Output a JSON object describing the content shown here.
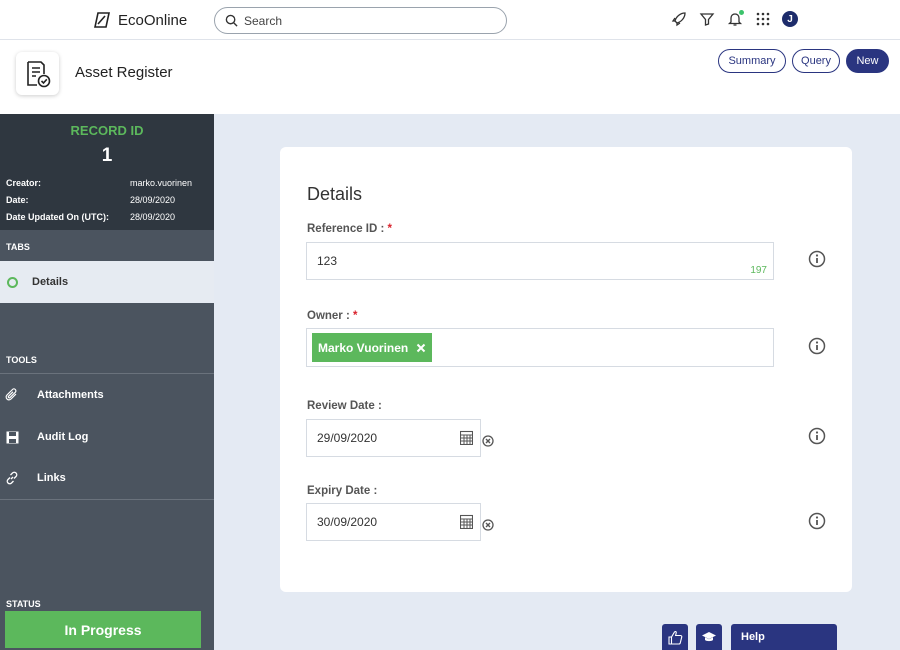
{
  "app": {
    "brand": "EcoOnline",
    "page_title": "Asset Register"
  },
  "search": {
    "placeholder": "Search",
    "value": ""
  },
  "user": {
    "initial": "J"
  },
  "header_buttons": {
    "summary": "Summary",
    "query": "Query",
    "new": "New"
  },
  "record": {
    "label": "RECORD ID",
    "id": "1",
    "meta": [
      {
        "key": "Creator:",
        "value": "marko.vuorinen"
      },
      {
        "key": "Date:",
        "value": "28/09/2020"
      },
      {
        "key": "Date Updated On (UTC):",
        "value": "28/09/2020"
      }
    ]
  },
  "sidebar": {
    "tabs_title": "TABS",
    "tabs": [
      {
        "label": "Details"
      }
    ],
    "tools_title": "TOOLS",
    "tools": [
      {
        "label": "Attachments",
        "icon": "paperclip-icon"
      },
      {
        "label": "Audit Log",
        "icon": "save-icon"
      },
      {
        "label": "Links",
        "icon": "link-icon"
      }
    ],
    "status_title": "STATUS",
    "status_value": "In Progress"
  },
  "form": {
    "title": "Details",
    "reference": {
      "label": "Reference ID :",
      "required": "*",
      "value": "123",
      "counter": "197"
    },
    "owner": {
      "label": "Owner :",
      "required": "*",
      "chip": "Marko Vuorinen"
    },
    "review": {
      "label": "Review Date :",
      "value": "29/09/2020"
    },
    "expiry": {
      "label": "Expiry Date :",
      "value": "30/09/2020"
    }
  },
  "footer": {
    "help": "Help"
  },
  "colors": {
    "accent": "#2a3580",
    "success": "#5cb85c",
    "sidebar": "#4b545f",
    "required": "#d9232d"
  }
}
